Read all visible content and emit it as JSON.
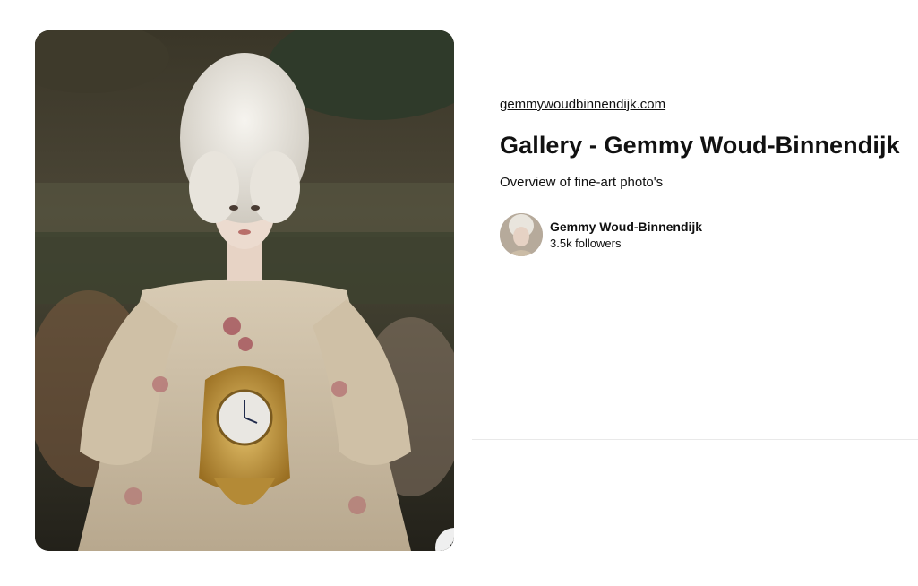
{
  "pin": {
    "source_link": "gemmywoudbinnendijk.com",
    "title": "Gallery - Gemmy Woud-Binnendijk",
    "description": "Overview of fine-art photo's",
    "image_subject": "fine-art portrait of woman with tall white powdered wig holding gilded clock",
    "shop_icon": "shopping-bag-icon"
  },
  "creator": {
    "name": "Gemmy Woud-Binnendijk",
    "followers": "3.5k followers"
  },
  "colors": {
    "text": "#111111",
    "divider": "#e9e9e9",
    "shop_button_bg": "#efefef"
  }
}
